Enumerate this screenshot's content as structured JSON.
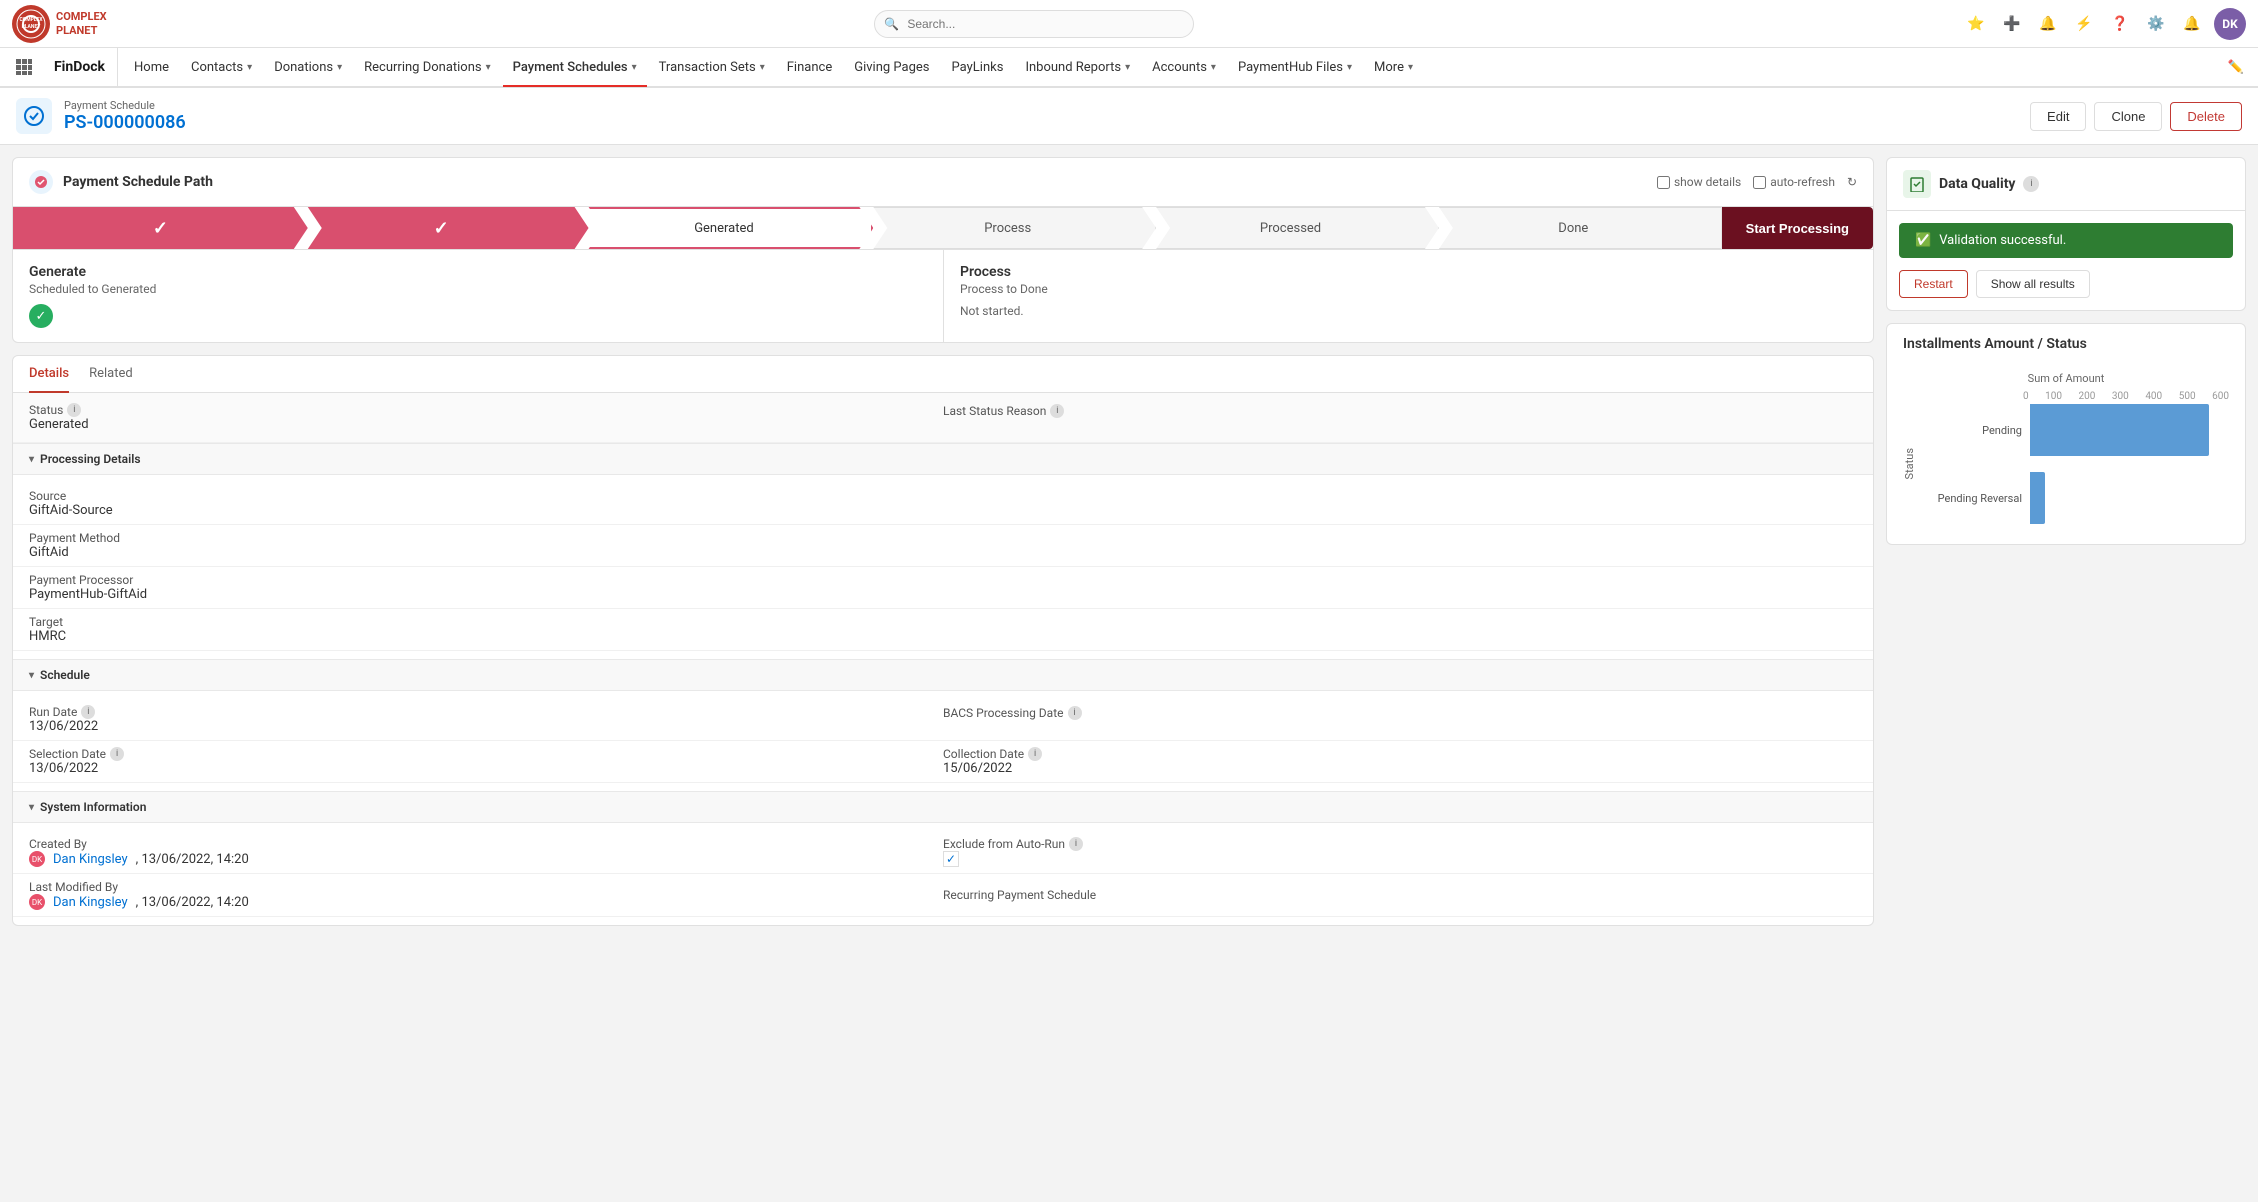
{
  "topBar": {
    "logo": "CP",
    "logoLine1": "COMPLEX",
    "logoLine2": "PLANET",
    "searchPlaceholder": "Search...",
    "icons": [
      "star",
      "plus",
      "bell-wave",
      "lightning",
      "question",
      "gear",
      "bell",
      "avatar"
    ]
  },
  "navBar": {
    "brand": "FinDock",
    "items": [
      {
        "label": "Home",
        "hasDropdown": false
      },
      {
        "label": "Contacts",
        "hasDropdown": true
      },
      {
        "label": "Donations",
        "hasDropdown": true
      },
      {
        "label": "Recurring Donations",
        "hasDropdown": true
      },
      {
        "label": "Payment Schedules",
        "hasDropdown": true,
        "active": true
      },
      {
        "label": "Transaction Sets",
        "hasDropdown": true
      },
      {
        "label": "Finance",
        "hasDropdown": false
      },
      {
        "label": "Giving Pages",
        "hasDropdown": false
      },
      {
        "label": "PayLinks",
        "hasDropdown": false
      },
      {
        "label": "Inbound Reports",
        "hasDropdown": true
      },
      {
        "label": "Accounts",
        "hasDropdown": true
      },
      {
        "label": "PaymentHub Files",
        "hasDropdown": true
      },
      {
        "label": "More",
        "hasDropdown": true
      }
    ]
  },
  "recordHeader": {
    "type": "Payment Schedule",
    "name": "PS-000000086",
    "actions": {
      "edit": "Edit",
      "clone": "Clone",
      "delete": "Delete"
    }
  },
  "paymentPath": {
    "title": "Payment Schedule Path",
    "showDetails": "show details",
    "autoRefresh": "auto-refresh",
    "steps": [
      {
        "label": "✓",
        "state": "completed"
      },
      {
        "label": "✓",
        "state": "completed"
      },
      {
        "label": "Generated",
        "state": "active"
      },
      {
        "label": "Process",
        "state": "inactive"
      },
      {
        "label": "Processed",
        "state": "inactive"
      },
      {
        "label": "Done",
        "state": "inactive"
      }
    ],
    "startButton": "Start Processing",
    "processAreas": [
      {
        "title": "Generate",
        "subtitle": "Scheduled to Generated",
        "status": "completed"
      },
      {
        "title": "Process",
        "subtitle": "Process to Done",
        "status": "Not started."
      }
    ]
  },
  "details": {
    "tabs": [
      "Details",
      "Related"
    ],
    "activeTab": "Details",
    "statusRow": {
      "statusLabel": "Status",
      "statusValue": "Generated",
      "lastStatusReasonLabel": "Last Status Reason"
    },
    "processingDetails": {
      "sectionTitle": "Processing Details",
      "fields": [
        {
          "label": "Source",
          "value": "GiftAid-Source"
        },
        {
          "label": "Payment Method",
          "value": "GiftAid"
        },
        {
          "label": "Payment Processor",
          "value": "PaymentHub-GiftAid"
        },
        {
          "label": "Target",
          "value": "HMRC"
        }
      ]
    },
    "schedule": {
      "sectionTitle": "Schedule",
      "runDateLabel": "Run Date",
      "runDateValue": "13/06/2022",
      "selectionDateLabel": "Selection Date",
      "selectionDateValue": "13/06/2022",
      "bacsProcessingDateLabel": "BACS Processing Date",
      "collectionDateLabel": "Collection Date",
      "collectionDateValue": "15/06/2022"
    },
    "systemInfo": {
      "sectionTitle": "System Information",
      "createdByLabel": "Created By",
      "createdByValue": "Dan Kingsley",
      "createdByDate": "13/06/2022, 14:20",
      "lastModifiedByLabel": "Last Modified By",
      "lastModifiedByValue": "Dan Kingsley",
      "lastModifiedDate": "13/06/2022, 14:20",
      "excludeAutoRunLabel": "Exclude from Auto-Run",
      "recurringPaymentLabel": "Recurring Payment Schedule"
    }
  },
  "dataQuality": {
    "title": "Data Quality",
    "validationMessage": "Validation successful.",
    "restartButton": "Restart",
    "showAllResultsButton": "Show all results"
  },
  "chart": {
    "title": "Installments Amount / Status",
    "sumOfAmountLabel": "Sum of Amount",
    "axisLabels": [
      "0",
      "100",
      "200",
      "300",
      "400",
      "500",
      "600"
    ],
    "bars": [
      {
        "label": "Pending",
        "value": 540,
        "maxValue": 600
      },
      {
        "label": "Pending Reversal",
        "value": 45,
        "maxValue": 600
      }
    ],
    "yAxisLabel": "Status"
  }
}
